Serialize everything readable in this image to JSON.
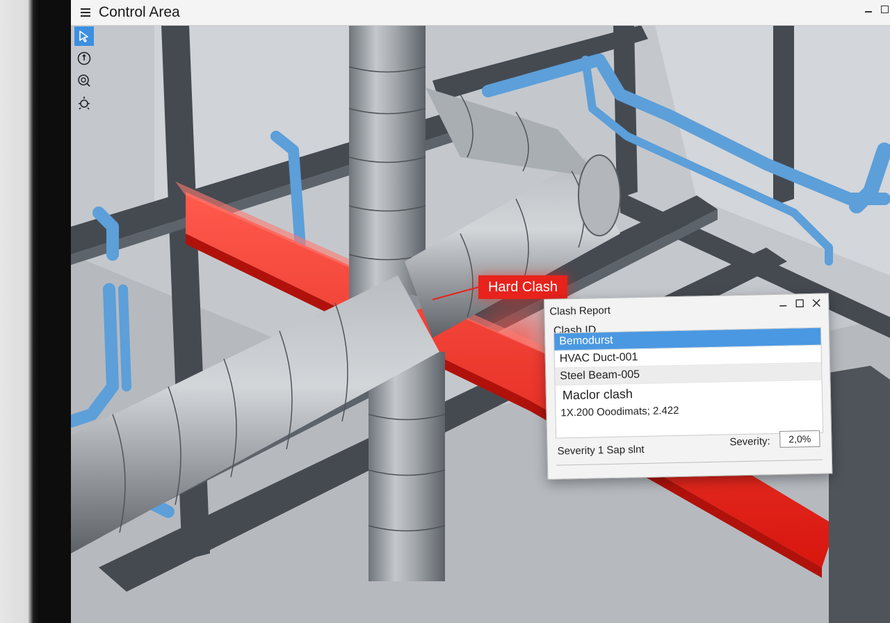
{
  "app": {
    "title": "Control Area"
  },
  "toolbar": {
    "tools": [
      {
        "name": "select",
        "icon": "cursor-arrow-icon",
        "active": true
      },
      {
        "name": "orbit",
        "icon": "orbit-icon",
        "active": false
      },
      {
        "name": "zoom",
        "icon": "zoom-icon",
        "active": false
      },
      {
        "name": "pan",
        "icon": "pan-icon",
        "active": false
      }
    ]
  },
  "viewport": {
    "clash_marker": {
      "label": "Hard Clash",
      "color": "#e8221c"
    },
    "colors": {
      "duct": "#9ea4aa",
      "pipe": "#5c9fd9",
      "steel": "#4a4f56",
      "clash_beam": "#ff2a1f"
    }
  },
  "clash_report": {
    "title": "Clash Report",
    "field_header": "Clash ID",
    "rows": [
      {
        "text": "Bemodurst",
        "state": "selected"
      },
      {
        "text": "HVAC Duct-001",
        "state": "normal"
      },
      {
        "text": "Steel Beam-005",
        "state": "alternate"
      }
    ],
    "description": "Maclor clash",
    "coordinates": "1X.200 Ooodimats; 2.422",
    "footer": "Severity 1 Sap slnt",
    "severity_label": "Severity:",
    "severity_value": "2,0%",
    "accent": "#4a98e2"
  }
}
